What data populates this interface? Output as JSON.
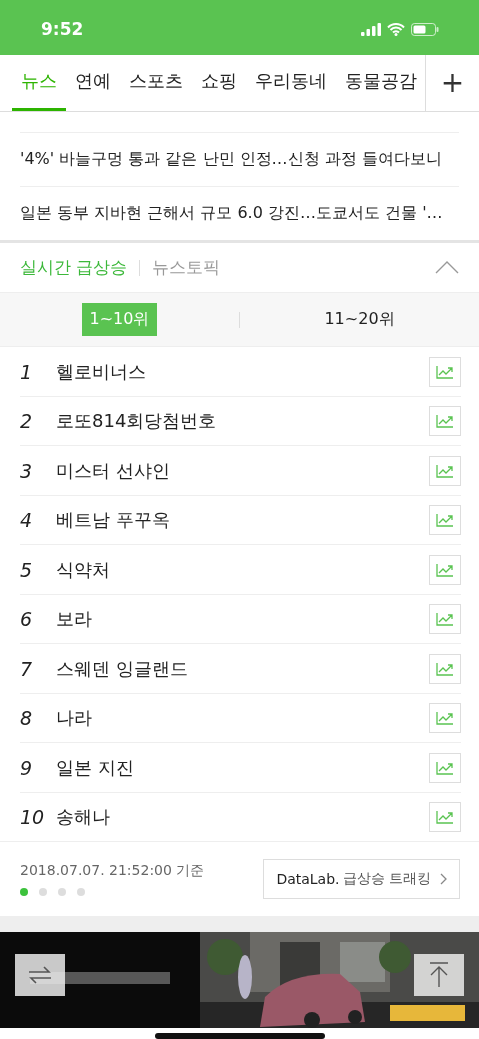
{
  "status_bar": {
    "time": "9:52"
  },
  "tabs": [
    {
      "label": "뉴스",
      "selected": true
    },
    {
      "label": "연예",
      "selected": false
    },
    {
      "label": "스포츠",
      "selected": false
    },
    {
      "label": "쇼핑",
      "selected": false
    },
    {
      "label": "우리동네",
      "selected": false
    },
    {
      "label": "동물공감",
      "selected": false
    }
  ],
  "add_tab": "+",
  "news": [
    {
      "title": "'4%' 바늘구멍 통과 같은 난민 인정…신청 과정 들여다보니"
    },
    {
      "title": "일본 동부 지바현 근해서 규모 6.0 강진…도쿄서도 건물 '…"
    }
  ],
  "section_tabs": [
    {
      "label": "실시간 급상승",
      "selected": true
    },
    {
      "label": "뉴스토픽",
      "selected": false
    }
  ],
  "expanded": true,
  "ranges": [
    {
      "label": "1~10위",
      "selected": true
    },
    {
      "label": "11~20위",
      "selected": false
    }
  ],
  "ranking": [
    {
      "rank": "1",
      "keyword": "헬로비너스"
    },
    {
      "rank": "2",
      "keyword": "로또814회당첨번호"
    },
    {
      "rank": "3",
      "keyword": "미스터 선샤인"
    },
    {
      "rank": "4",
      "keyword": "베트남 푸꾸옥"
    },
    {
      "rank": "5",
      "keyword": "식약처"
    },
    {
      "rank": "6",
      "keyword": "보라"
    },
    {
      "rank": "7",
      "keyword": "스웨덴 잉글랜드"
    },
    {
      "rank": "8",
      "keyword": "나라"
    },
    {
      "rank": "9",
      "keyword": "일본 지진"
    },
    {
      "rank": "10",
      "keyword": "송해나"
    }
  ],
  "footer": {
    "timestamp": "2018.07.07. 21:52:00 기준",
    "pages": [
      {
        "selected": true
      },
      {
        "selected": false
      },
      {
        "selected": false
      },
      {
        "selected": false
      }
    ],
    "datalab_brand": "DataLab.",
    "datalab_label": "급상승 트래킹"
  }
}
